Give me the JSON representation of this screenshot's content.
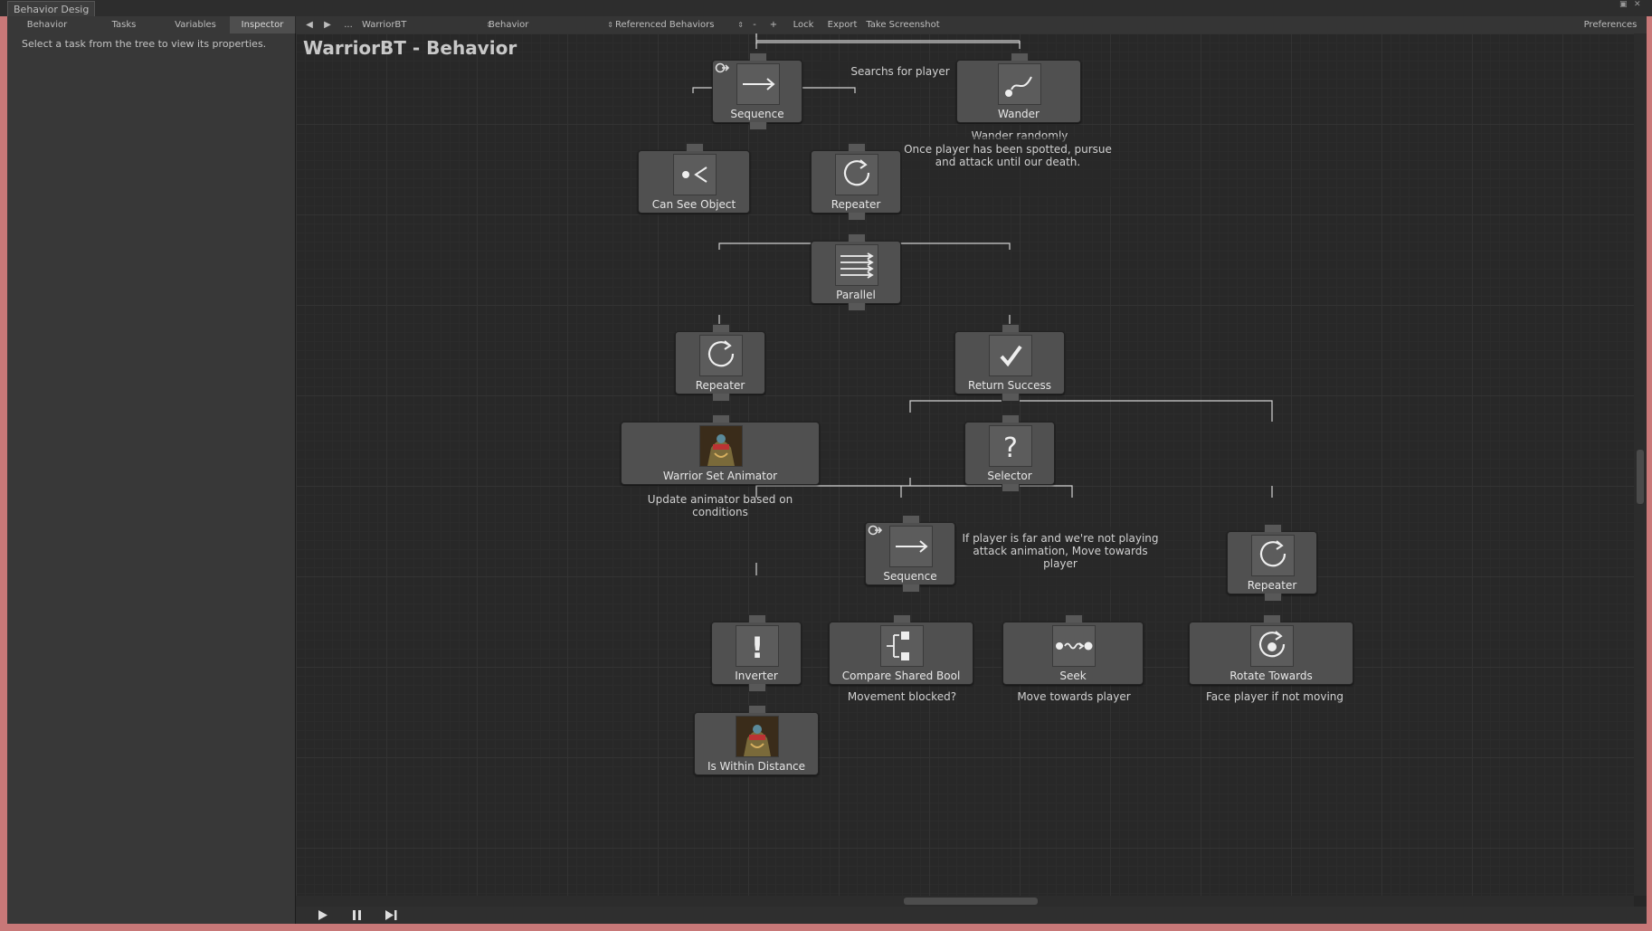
{
  "window": {
    "tab_title": "Behavior Desig"
  },
  "toolbar": {
    "tabs": [
      "Behavior",
      "Tasks",
      "Variables",
      "Inspector"
    ],
    "nav_dots": "...",
    "tree_select": "WarriorBT",
    "behavior_select": "Behavior",
    "referenced": "Referenced Behaviors",
    "minus": "-",
    "plus": "+",
    "lock": "Lock",
    "export": "Export",
    "screenshot": "Take Screenshot",
    "preferences": "Preferences"
  },
  "inspector": {
    "message": "Select a task from the tree to view its properties."
  },
  "graph": {
    "title": "WarriorBT - Behavior",
    "nodes": {
      "sequence_top": {
        "label": "Sequence",
        "icon": "sequence-arrow-icon"
      },
      "wander": {
        "label": "Wander",
        "icon": "wander-icon"
      },
      "can_see": {
        "label": "Can See Object",
        "icon": "can-see-object-icon"
      },
      "repeater_1": {
        "label": "Repeater",
        "icon": "repeater-icon"
      },
      "parallel": {
        "label": "Parallel",
        "icon": "parallel-icon"
      },
      "repeater_2": {
        "label": "Repeater",
        "icon": "repeater-icon"
      },
      "return_success": {
        "label": "Return Success",
        "icon": "checkmark-icon"
      },
      "set_animator": {
        "label": "Warrior Set Animator",
        "icon": "warrior-portrait-icon"
      },
      "selector": {
        "label": "Selector",
        "icon": "question-icon"
      },
      "sequence_mid": {
        "label": "Sequence",
        "icon": "sequence-arrow-icon"
      },
      "repeater_3": {
        "label": "Repeater",
        "icon": "repeater-icon"
      },
      "inverter": {
        "label": "Inverter",
        "icon": "exclamation-icon"
      },
      "compare_bool": {
        "label": "Compare Shared Bool",
        "icon": "compare-icon"
      },
      "seek": {
        "label": "Seek",
        "icon": "seek-icon"
      },
      "rotate": {
        "label": "Rotate Towards",
        "icon": "rotate-towards-icon"
      },
      "within_distance": {
        "label": "Is Within Distance",
        "icon": "warrior-portrait-icon"
      }
    },
    "comments": {
      "searches": "Searchs for player",
      "wander": "Wander randomly",
      "pursue": "Once player has been spotted, pursue and attack until our death.",
      "animator": "Update animator based on conditions",
      "move": "If player is far and we're not playing attack animation, Move towards player",
      "blocked": "Movement blocked?",
      "seek": "Move towards player",
      "face": "Face player if not moving"
    }
  },
  "colors": {
    "canvas": "#282828",
    "node": "#505050",
    "panel": "#383838",
    "frame": "#c87878"
  }
}
